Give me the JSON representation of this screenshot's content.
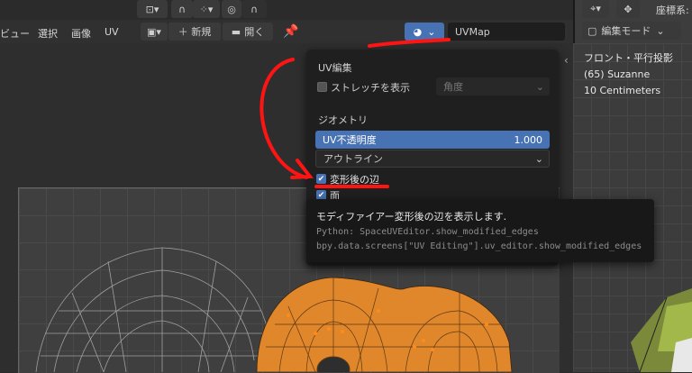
{
  "header": {
    "menu": [
      "ビュー",
      "選択",
      "画像",
      "UV"
    ],
    "new_label": "＋ 新規",
    "open_label": "開く",
    "uvmap_field": "UVMap"
  },
  "popover": {
    "title": "UV編集",
    "stretch_label": "ストレッチを表示",
    "stretch_mode": "角度",
    "geometry_title": "ジオメトリ",
    "uv_opacity_label": "UV不透明度",
    "uv_opacity_value": "1.000",
    "outline_mode": "アウトライン",
    "modified_edges_label": "変形後の辺",
    "faces_label": "面"
  },
  "tooltip": {
    "description": "モディファイアー変形後の辺を表示します.",
    "python_line1": "Python: SpaceUVEditor.show_modified_edges",
    "python_line2": "bpy.data.screens[\"UV Editing\"].uv_editor.show_modified_edges"
  },
  "right_panel": {
    "coord_label": "座標系:",
    "mode_label": "編集モード",
    "view_name": "フロント・平行投影",
    "object_name": "(65) Suzanne",
    "scale_text": "10 Centimeters"
  },
  "colors": {
    "accent_blue": "#4772b3",
    "mesh_orange": "#e0862b",
    "annotation_red": "#ff1414",
    "checkbox_blue": "#4772b3"
  }
}
